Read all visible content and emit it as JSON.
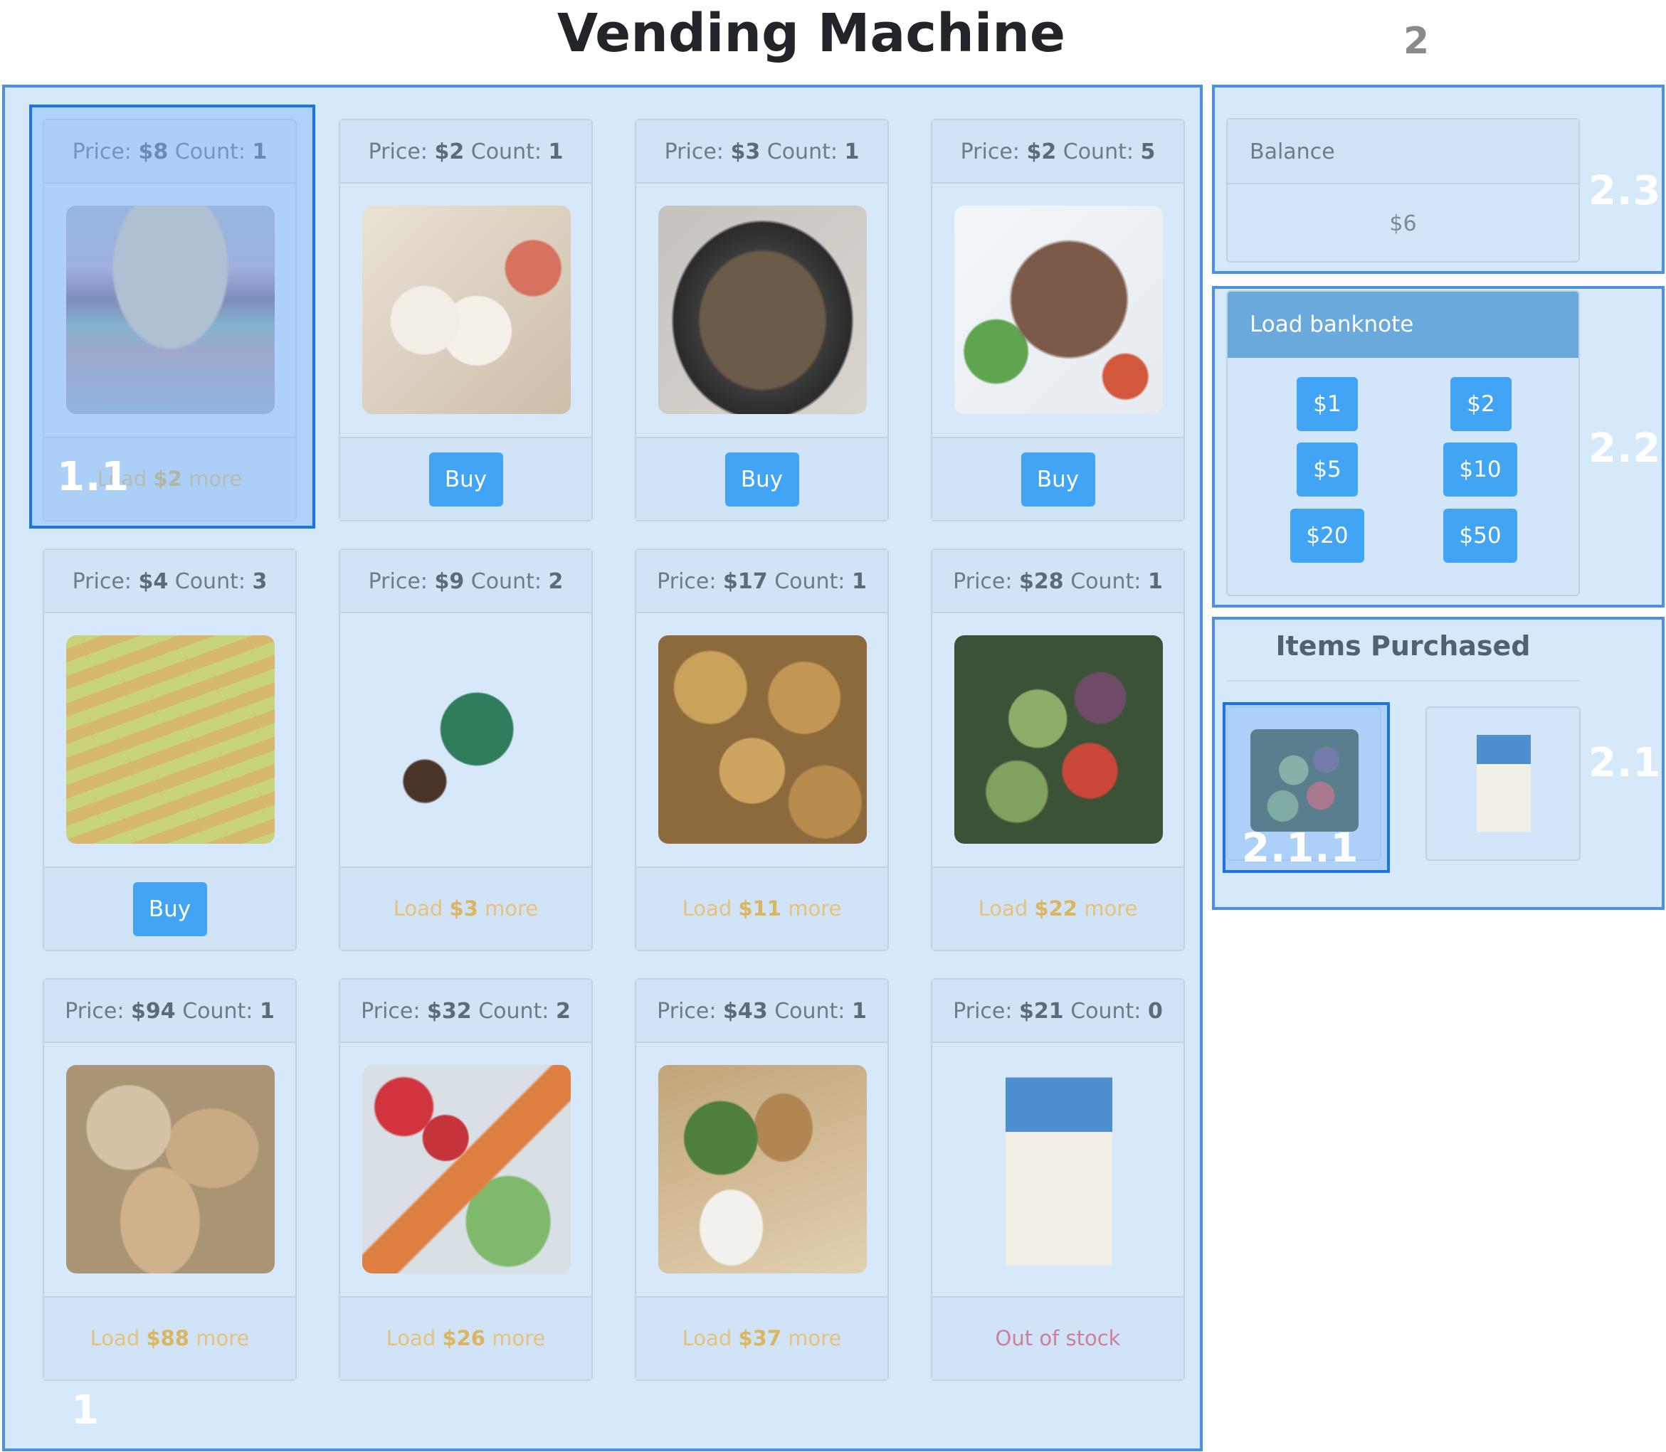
{
  "title": "Vending Machine",
  "markers": {
    "m1": "1",
    "m11": "1.1",
    "m2": "2",
    "m21": "2.1",
    "m211": "2.1.1",
    "m22": "2.2",
    "m23": "2.3"
  },
  "products": [
    {
      "price_label": "Price:",
      "price": "$8",
      "count_label": "Count:",
      "count": "1",
      "image": "burger",
      "status": "load",
      "load_prefix": "Load",
      "load_amount": "$2",
      "load_suffix": "more"
    },
    {
      "price_label": "Price:",
      "price": "$2",
      "count_label": "Count:",
      "count": "1",
      "image": "spring-rolls",
      "status": "buy",
      "buy_label": "Buy"
    },
    {
      "price_label": "Price:",
      "price": "$3",
      "count_label": "Count:",
      "count": "1",
      "image": "stir-fry-pot",
      "status": "buy",
      "buy_label": "Buy"
    },
    {
      "price_label": "Price:",
      "price": "$2",
      "count_label": "Count:",
      "count": "5",
      "image": "beef-salad",
      "status": "buy",
      "buy_label": "Buy"
    },
    {
      "price_label": "Price:",
      "price": "$4",
      "count_label": "Count:",
      "count": "3",
      "image": "cheese-bread",
      "status": "buy",
      "buy_label": "Buy"
    },
    {
      "price_label": "Price:",
      "price": "$9",
      "count_label": "Count:",
      "count": "2",
      "image": "biscuits-box",
      "status": "load",
      "load_prefix": "Load",
      "load_amount": "$3",
      "load_suffix": "more"
    },
    {
      "price_label": "Price:",
      "price": "$17",
      "count_label": "Count:",
      "count": "1",
      "image": "bread-rolls",
      "status": "load",
      "load_prefix": "Load",
      "load_amount": "$11",
      "load_suffix": "more"
    },
    {
      "price_label": "Price:",
      "price": "$28",
      "count_label": "Count:",
      "count": "1",
      "image": "grilled-vegetables",
      "status": "load",
      "load_prefix": "Load",
      "load_amount": "$22",
      "load_suffix": "more"
    },
    {
      "price_label": "Price:",
      "price": "$94",
      "count_label": "Count:",
      "count": "1",
      "image": "bread-loaves",
      "status": "load",
      "load_prefix": "Load",
      "load_amount": "$88",
      "load_suffix": "more"
    },
    {
      "price_label": "Price:",
      "price": "$32",
      "count_label": "Count:",
      "count": "2",
      "image": "crudites",
      "status": "load",
      "load_prefix": "Load",
      "load_amount": "$26",
      "load_suffix": "more"
    },
    {
      "price_label": "Price:",
      "price": "$43",
      "count_label": "Count:",
      "count": "1",
      "image": "sushi-box",
      "status": "load",
      "load_prefix": "Load",
      "load_amount": "$37",
      "load_suffix": "more"
    },
    {
      "price_label": "Price:",
      "price": "$21",
      "count_label": "Count:",
      "count": "0",
      "image": "bounty-cookies",
      "status": "out",
      "out_label": "Out of stock"
    }
  ],
  "balance": {
    "label": "Balance",
    "value": "$6"
  },
  "banknotes": {
    "label": "Load banknote",
    "notes": [
      "$1",
      "$2",
      "$5",
      "$10",
      "$20",
      "$50"
    ]
  },
  "purchased": {
    "title": "Items Purchased",
    "items": [
      {
        "image": "grilled-vegetables"
      },
      {
        "image": "bounty-cookies"
      }
    ]
  },
  "colors": {
    "accent": "#42a4f5",
    "highlight": "#1a73e8",
    "region_bg": "#d6e9fb",
    "warning_text": "#e6c27a",
    "danger_text": "#d07f97"
  }
}
